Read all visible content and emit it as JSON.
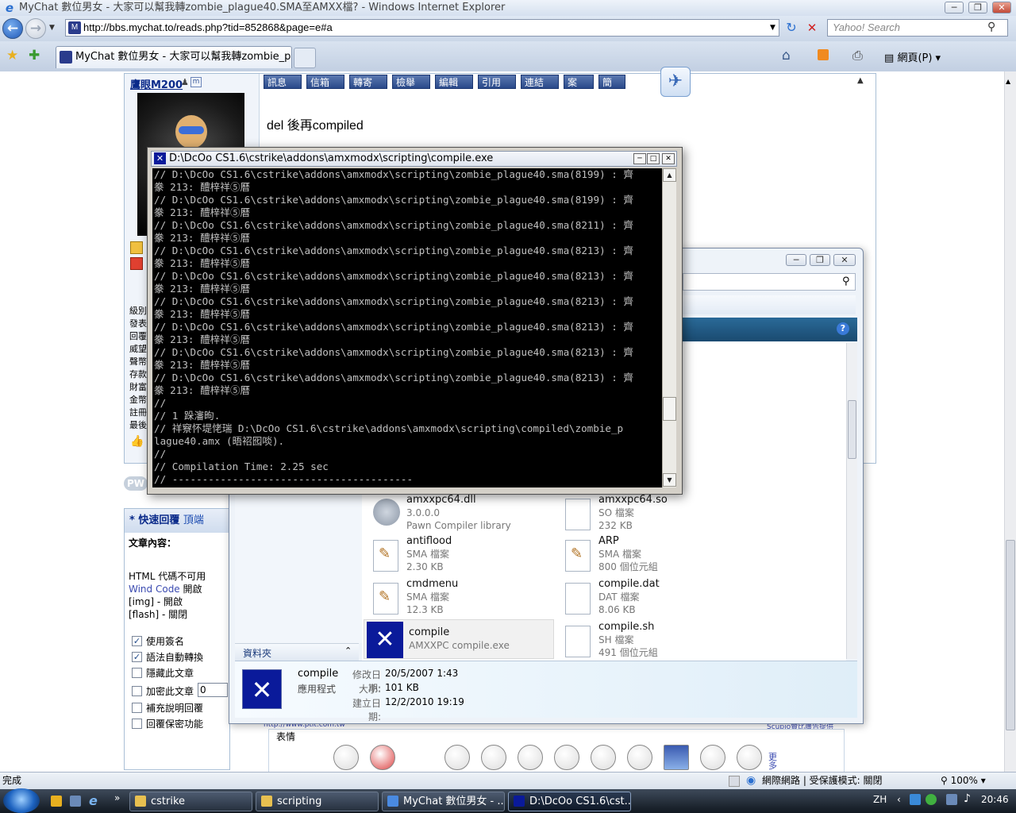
{
  "window": {
    "title": "MyChat 數位男女 - 大家可以幫我轉zombie_plague40.SMA至AMXX檔? - Windows Internet Explorer",
    "minimize": "─",
    "restore": "❐",
    "close": "✕"
  },
  "nav": {
    "back": "←",
    "forward": "→",
    "address": "http://bbs.mychat.to/reads.php?tid=852868&page=e#a",
    "refresh": "↻",
    "stop": "✕",
    "search_placeholder": "Yahoo! Search"
  },
  "tabs": {
    "active_label": "MyChat 數位男女 - 大家可以幫我轉zombie_pla...",
    "page_menu": "網頁(P)"
  },
  "forum": {
    "username": "鷹眼M200",
    "buttons": [
      "訊息",
      "信箱",
      "轉寄",
      "檢舉",
      "編輯",
      "引用",
      "連結",
      "案",
      "簡"
    ],
    "post_text": "del 後再compiled",
    "side_labels": [
      "級別",
      "發表",
      "回覆",
      "威望",
      "聲幣",
      "存款",
      "財富",
      "金幣",
      "註冊",
      "最後"
    ],
    "pw_badge": "PW",
    "ad_left": "http://www.ptit.com.tw",
    "ad_right": "Scupio贊比廣告提供",
    "emoji_label": "表情",
    "more": "更多"
  },
  "quick_reply": {
    "title": "* 快速回覆",
    "top_link": "頂端",
    "content_label": "文章內容：",
    "html_note": "HTML 代碼不可用",
    "wind_code": "Wind Code",
    "wind_open": "開啟",
    "img_note": "[img] - 開啟",
    "flash_note": "[flash] - 關閉",
    "options": [
      {
        "label": "使用簽名",
        "checked": true
      },
      {
        "label": "語法自動轉換",
        "checked": true
      },
      {
        "label": "隱藏此文章",
        "checked": false
      },
      {
        "label": "加密此文章",
        "checked": false
      },
      {
        "label": "補充說明回覆",
        "checked": false
      },
      {
        "label": "回覆保密功能",
        "checked": false
      }
    ],
    "encrypt_value": "0"
  },
  "explorer": {
    "folder_pane_label": "資料夾",
    "files": [
      {
        "name": "amxxpc64.dll",
        "line1": "3.0.0.0",
        "line2": "Pawn Compiler library"
      },
      {
        "name": "amxxpc64.so",
        "line1": "SO 檔案",
        "line2": "232 KB"
      },
      {
        "name": "antiflood",
        "line1": "SMA 檔案",
        "line2": "2.30 KB"
      },
      {
        "name": "ARP",
        "line1": "SMA 檔案",
        "line2": "800 個位元組"
      },
      {
        "name": "cmdmenu",
        "line1": "SMA 檔案",
        "line2": "12.3 KB"
      },
      {
        "name": "compile.dat",
        "line1": "DAT 檔案",
        "line2": "8.06 KB"
      },
      {
        "name": "compile",
        "line1": "AMXXPC compile.exe",
        "line2": ""
      },
      {
        "name": "compile.sh",
        "line1": "SH 檔案",
        "line2": "491 個位元組"
      }
    ],
    "details": {
      "name": "compile",
      "type": "應用程式",
      "modified_label": "修改日期:",
      "modified": "20/5/2007 1:43",
      "size_label": "大小:",
      "size": "101 KB",
      "created_label": "建立日期:",
      "created": "12/2/2010 19:19"
    }
  },
  "console": {
    "title": "D:\\DcOo CS1.6\\cstrike\\addons\\amxmodx\\scripting\\compile.exe",
    "lines": [
      "// D:\\DcOo CS1.6\\cstrike\\addons\\amxmodx\\scripting\\zombie_plague40.sma(8199) : 齊",
      "豢 213: 醴梓祥⑤曆",
      "// D:\\DcOo CS1.6\\cstrike\\addons\\amxmodx\\scripting\\zombie_plague40.sma(8199) : 齊",
      "豢 213: 醴梓祥⑤曆",
      "// D:\\DcOo CS1.6\\cstrike\\addons\\amxmodx\\scripting\\zombie_plague40.sma(8211) : 齊",
      "豢 213: 醴梓祥⑤曆",
      "// D:\\DcOo CS1.6\\cstrike\\addons\\amxmodx\\scripting\\zombie_plague40.sma(8213) : 齊",
      "豢 213: 醴梓祥⑤曆",
      "// D:\\DcOo CS1.6\\cstrike\\addons\\amxmodx\\scripting\\zombie_plague40.sma(8213) : 齊",
      "豢 213: 醴梓祥⑤曆",
      "// D:\\DcOo CS1.6\\cstrike\\addons\\amxmodx\\scripting\\zombie_plague40.sma(8213) : 齊",
      "豢 213: 醴梓祥⑤曆",
      "// D:\\DcOo CS1.6\\cstrike\\addons\\amxmodx\\scripting\\zombie_plague40.sma(8213) : 齊",
      "豢 213: 醴梓祥⑤曆",
      "// D:\\DcOo CS1.6\\cstrike\\addons\\amxmodx\\scripting\\zombie_plague40.sma(8213) : 齊",
      "豢 213: 醴梓祥⑤曆",
      "// D:\\DcOo CS1.6\\cstrike\\addons\\amxmodx\\scripting\\zombie_plague40.sma(8213) : 齊",
      "豢 213: 醴梓祥⑤曆",
      "//",
      "// 1 跺瀋昫.",
      "// 祥竂怀堤恅瑞 D:\\DcOo CS1.6\\cstrike\\addons\\amxmodx\\scripting\\compiled\\zombie_p",
      "lague40.amx (晤祒囮啖).",
      "//",
      "// Compilation Time: 2.25 sec",
      "// ----------------------------------------"
    ]
  },
  "status": {
    "text": "完成",
    "zone": "網際網路 | 受保護模式: 關閉",
    "zoom": "100%"
  },
  "taskbar": {
    "items": [
      "cstrike",
      "scripting",
      "MyChat 數位男女 - ...",
      "D:\\DcOo CS1.6\\cst..."
    ],
    "lang": "ZH",
    "clock": "20:46"
  }
}
